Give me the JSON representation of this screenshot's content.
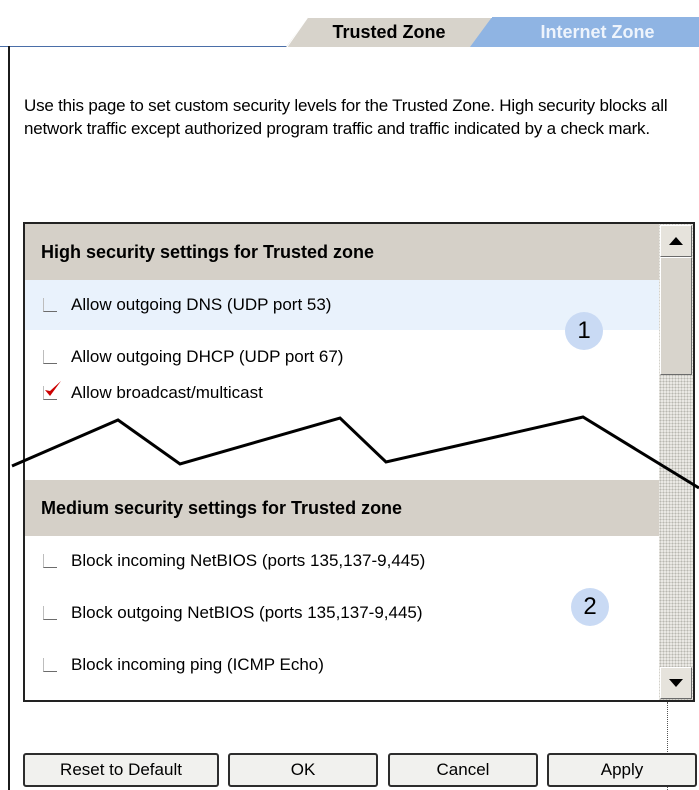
{
  "tabs": [
    {
      "label": "Trusted Zone",
      "active": true
    },
    {
      "label": "Internet Zone",
      "active": false
    }
  ],
  "description": "Use this page to set custom security levels for the Trusted Zone.  High security blocks all network traffic except authorized program traffic and traffic indicated by a check mark.",
  "high_section": {
    "title": "High security settings for Trusted zone",
    "items": [
      {
        "label": "Allow outgoing DNS (UDP port 53)",
        "checked": false
      },
      {
        "label": "Allow outgoing DHCP (UDP port 67)",
        "checked": false
      },
      {
        "label": "Allow broadcast/multicast",
        "checked": true
      }
    ],
    "callout": "1"
  },
  "medium_section": {
    "title": "Medium security settings for Trusted zone",
    "items": [
      {
        "label": "Block incoming NetBIOS (ports 135,137-9,445)",
        "checked": false
      },
      {
        "label": "Block outgoing NetBIOS (ports 135,137-9,445)",
        "checked": false
      },
      {
        "label": "Block incoming ping (ICMP Echo)",
        "checked": false
      }
    ],
    "callout": "2"
  },
  "buttons": {
    "reset": "Reset to Default",
    "ok": "OK",
    "cancel": "Cancel",
    "apply": "Apply"
  },
  "colors": {
    "active_tab": "#d7d3cb",
    "inactive_tab": "#8fb4e3",
    "section_header": "#d5d0c8",
    "highlight_row": "#e9f2fc",
    "callout": "#c9daf4",
    "checkmark": "#cc0000"
  },
  "icons": {
    "checkmark": "red-checkmark-icon",
    "scroll_up": "triangle-up-icon",
    "scroll_down": "triangle-down-icon"
  }
}
